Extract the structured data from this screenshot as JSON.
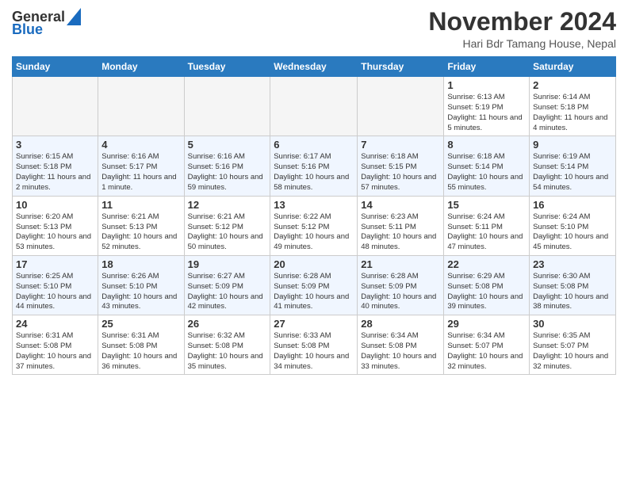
{
  "header": {
    "logo_line1": "General",
    "logo_line2": "Blue",
    "month": "November 2024",
    "location": "Hari Bdr Tamang House, Nepal"
  },
  "weekdays": [
    "Sunday",
    "Monday",
    "Tuesday",
    "Wednesday",
    "Thursday",
    "Friday",
    "Saturday"
  ],
  "weeks": [
    [
      {
        "day": "",
        "empty": true
      },
      {
        "day": "",
        "empty": true
      },
      {
        "day": "",
        "empty": true
      },
      {
        "day": "",
        "empty": true
      },
      {
        "day": "",
        "empty": true
      },
      {
        "day": "1",
        "sunrise": "Sunrise: 6:13 AM",
        "sunset": "Sunset: 5:19 PM",
        "daylight": "Daylight: 11 hours and 5 minutes."
      },
      {
        "day": "2",
        "sunrise": "Sunrise: 6:14 AM",
        "sunset": "Sunset: 5:18 PM",
        "daylight": "Daylight: 11 hours and 4 minutes."
      }
    ],
    [
      {
        "day": "3",
        "sunrise": "Sunrise: 6:15 AM",
        "sunset": "Sunset: 5:18 PM",
        "daylight": "Daylight: 11 hours and 2 minutes."
      },
      {
        "day": "4",
        "sunrise": "Sunrise: 6:16 AM",
        "sunset": "Sunset: 5:17 PM",
        "daylight": "Daylight: 11 hours and 1 minute."
      },
      {
        "day": "5",
        "sunrise": "Sunrise: 6:16 AM",
        "sunset": "Sunset: 5:16 PM",
        "daylight": "Daylight: 10 hours and 59 minutes."
      },
      {
        "day": "6",
        "sunrise": "Sunrise: 6:17 AM",
        "sunset": "Sunset: 5:16 PM",
        "daylight": "Daylight: 10 hours and 58 minutes."
      },
      {
        "day": "7",
        "sunrise": "Sunrise: 6:18 AM",
        "sunset": "Sunset: 5:15 PM",
        "daylight": "Daylight: 10 hours and 57 minutes."
      },
      {
        "day": "8",
        "sunrise": "Sunrise: 6:18 AM",
        "sunset": "Sunset: 5:14 PM",
        "daylight": "Daylight: 10 hours and 55 minutes."
      },
      {
        "day": "9",
        "sunrise": "Sunrise: 6:19 AM",
        "sunset": "Sunset: 5:14 PM",
        "daylight": "Daylight: 10 hours and 54 minutes."
      }
    ],
    [
      {
        "day": "10",
        "sunrise": "Sunrise: 6:20 AM",
        "sunset": "Sunset: 5:13 PM",
        "daylight": "Daylight: 10 hours and 53 minutes."
      },
      {
        "day": "11",
        "sunrise": "Sunrise: 6:21 AM",
        "sunset": "Sunset: 5:13 PM",
        "daylight": "Daylight: 10 hours and 52 minutes."
      },
      {
        "day": "12",
        "sunrise": "Sunrise: 6:21 AM",
        "sunset": "Sunset: 5:12 PM",
        "daylight": "Daylight: 10 hours and 50 minutes."
      },
      {
        "day": "13",
        "sunrise": "Sunrise: 6:22 AM",
        "sunset": "Sunset: 5:12 PM",
        "daylight": "Daylight: 10 hours and 49 minutes."
      },
      {
        "day": "14",
        "sunrise": "Sunrise: 6:23 AM",
        "sunset": "Sunset: 5:11 PM",
        "daylight": "Daylight: 10 hours and 48 minutes."
      },
      {
        "day": "15",
        "sunrise": "Sunrise: 6:24 AM",
        "sunset": "Sunset: 5:11 PM",
        "daylight": "Daylight: 10 hours and 47 minutes."
      },
      {
        "day": "16",
        "sunrise": "Sunrise: 6:24 AM",
        "sunset": "Sunset: 5:10 PM",
        "daylight": "Daylight: 10 hours and 45 minutes."
      }
    ],
    [
      {
        "day": "17",
        "sunrise": "Sunrise: 6:25 AM",
        "sunset": "Sunset: 5:10 PM",
        "daylight": "Daylight: 10 hours and 44 minutes."
      },
      {
        "day": "18",
        "sunrise": "Sunrise: 6:26 AM",
        "sunset": "Sunset: 5:10 PM",
        "daylight": "Daylight: 10 hours and 43 minutes."
      },
      {
        "day": "19",
        "sunrise": "Sunrise: 6:27 AM",
        "sunset": "Sunset: 5:09 PM",
        "daylight": "Daylight: 10 hours and 42 minutes."
      },
      {
        "day": "20",
        "sunrise": "Sunrise: 6:28 AM",
        "sunset": "Sunset: 5:09 PM",
        "daylight": "Daylight: 10 hours and 41 minutes."
      },
      {
        "day": "21",
        "sunrise": "Sunrise: 6:28 AM",
        "sunset": "Sunset: 5:09 PM",
        "daylight": "Daylight: 10 hours and 40 minutes."
      },
      {
        "day": "22",
        "sunrise": "Sunrise: 6:29 AM",
        "sunset": "Sunset: 5:08 PM",
        "daylight": "Daylight: 10 hours and 39 minutes."
      },
      {
        "day": "23",
        "sunrise": "Sunrise: 6:30 AM",
        "sunset": "Sunset: 5:08 PM",
        "daylight": "Daylight: 10 hours and 38 minutes."
      }
    ],
    [
      {
        "day": "24",
        "sunrise": "Sunrise: 6:31 AM",
        "sunset": "Sunset: 5:08 PM",
        "daylight": "Daylight: 10 hours and 37 minutes."
      },
      {
        "day": "25",
        "sunrise": "Sunrise: 6:31 AM",
        "sunset": "Sunset: 5:08 PM",
        "daylight": "Daylight: 10 hours and 36 minutes."
      },
      {
        "day": "26",
        "sunrise": "Sunrise: 6:32 AM",
        "sunset": "Sunset: 5:08 PM",
        "daylight": "Daylight: 10 hours and 35 minutes."
      },
      {
        "day": "27",
        "sunrise": "Sunrise: 6:33 AM",
        "sunset": "Sunset: 5:08 PM",
        "daylight": "Daylight: 10 hours and 34 minutes."
      },
      {
        "day": "28",
        "sunrise": "Sunrise: 6:34 AM",
        "sunset": "Sunset: 5:08 PM",
        "daylight": "Daylight: 10 hours and 33 minutes."
      },
      {
        "day": "29",
        "sunrise": "Sunrise: 6:34 AM",
        "sunset": "Sunset: 5:07 PM",
        "daylight": "Daylight: 10 hours and 32 minutes."
      },
      {
        "day": "30",
        "sunrise": "Sunrise: 6:35 AM",
        "sunset": "Sunset: 5:07 PM",
        "daylight": "Daylight: 10 hours and 32 minutes."
      }
    ]
  ]
}
